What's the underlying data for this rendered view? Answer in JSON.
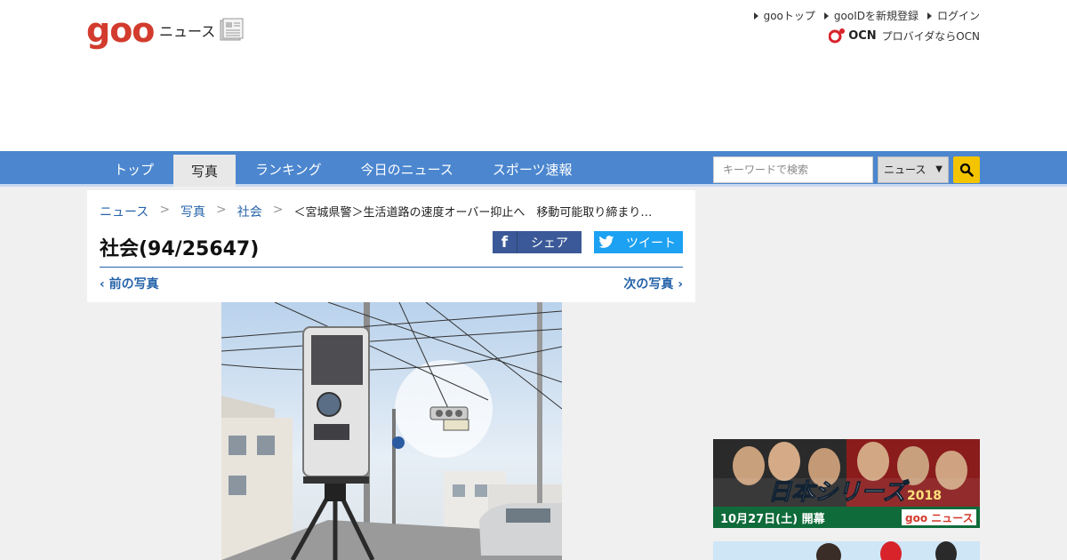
{
  "header": {
    "logo": "goo",
    "logo_sub": "ニュース",
    "links": [
      "gooトップ",
      "gooIDを新規登録",
      "ログイン"
    ],
    "ocn_logo": "OCN",
    "ocn_text": "プロバイダならOCN"
  },
  "nav": {
    "items": [
      "トップ",
      "写真",
      "ランキング",
      "今日のニュース",
      "スポーツ速報"
    ],
    "active_index": 1
  },
  "search": {
    "placeholder": "キーワードで検索",
    "category": "ニュース"
  },
  "breadcrumb": {
    "items": [
      "ニュース",
      "写真",
      "社会"
    ],
    "current": "＜宮城県警＞生活道路の速度オーバー抑止へ　移動可能取り締まり…"
  },
  "page": {
    "title": "社会(94/25647)",
    "share_facebook": "シェア",
    "share_twitter": "ツイート",
    "prev_label": "前の写真",
    "next_label": "次の写真"
  },
  "banner": {
    "title": "日本シリーズ",
    "year": "2018",
    "date": "10月27日(土) 開幕",
    "brand": "goo ニュース"
  },
  "colors": {
    "nav_bg": "#4b86cf",
    "link": "#2563a9",
    "logo_red": "#d23b2d",
    "facebook": "#3b5998",
    "twitter": "#1da1f2",
    "search_button": "#f5c400"
  }
}
